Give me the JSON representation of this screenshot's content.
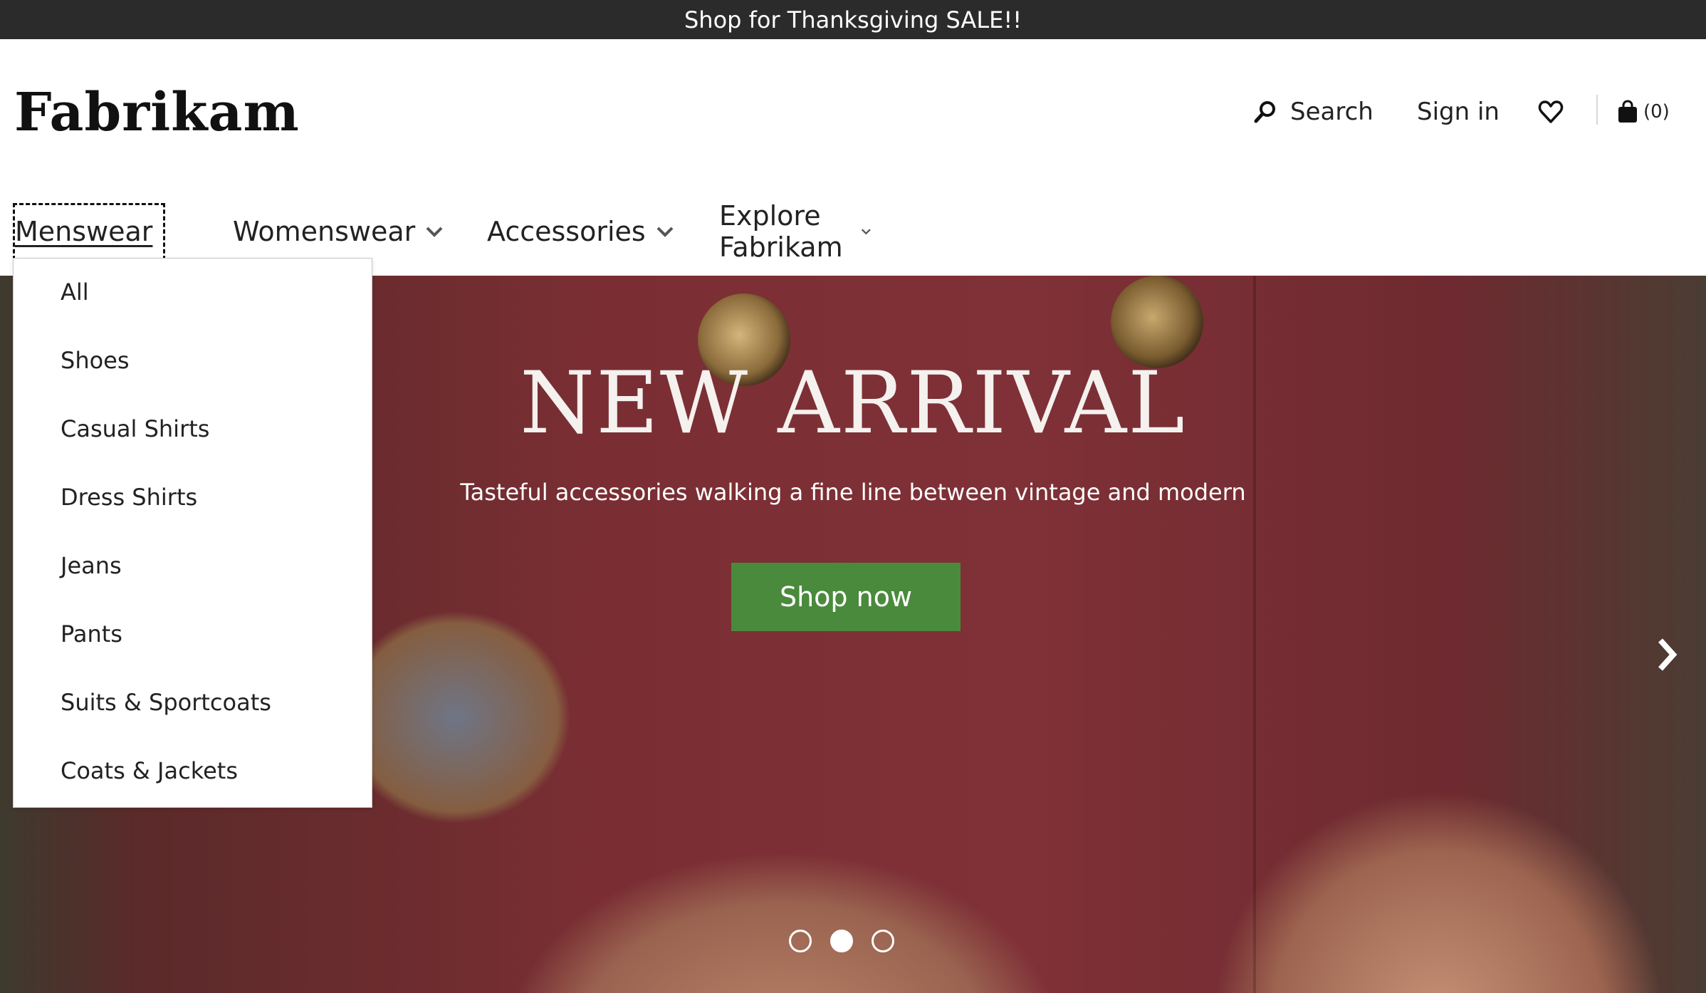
{
  "promo": {
    "text": "Shop for Thanksgiving SALE!!"
  },
  "brand": {
    "logo": "Fabrikam"
  },
  "utilities": {
    "search_label": "Search",
    "signin_label": "Sign in",
    "cart_count": "(0)"
  },
  "nav": {
    "items": [
      {
        "label": "Menswear",
        "active": true
      },
      {
        "label": "Womenswear"
      },
      {
        "label": "Accessories"
      },
      {
        "label": "Explore Fabrikam"
      }
    ]
  },
  "menswear_menu": {
    "items": [
      "All",
      "Shoes",
      "Casual Shirts",
      "Dress Shirts",
      "Jeans",
      "Pants",
      "Suits & Sportcoats",
      "Coats & Jackets"
    ]
  },
  "hero": {
    "title": "NEW ARRIVAL",
    "subtitle": "Tasteful accessories walking a fine line between vintage and modern",
    "cta_label": "Shop now",
    "slide_count": 3,
    "active_slide": 2
  },
  "icons": {
    "search": "search-icon",
    "wishlist": "heart-icon",
    "cart": "shopping-bag-icon",
    "chevron": "chevron-down-icon",
    "next": "chevron-right-icon"
  },
  "colors": {
    "promo_bg": "#2b2b2b",
    "cta_bg": "#4a8a3c",
    "hero_bg": "#7a2e33"
  }
}
